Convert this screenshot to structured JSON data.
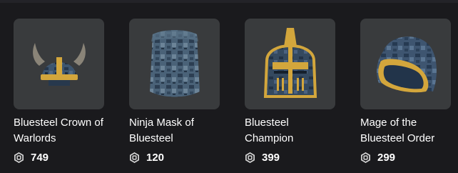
{
  "items": [
    {
      "name": "Bluesteel Crown of Warlords",
      "price": "749",
      "icon": "viking-helmet-image"
    },
    {
      "name": "Ninja Mask of Bluesteel",
      "price": "120",
      "icon": "ninja-mask-image"
    },
    {
      "name": "Bluesteel Champion",
      "price": "399",
      "icon": "knight-helmet-image"
    },
    {
      "name": "Mage of the Bluesteel Order",
      "price": "299",
      "icon": "mage-hood-image"
    }
  ],
  "currency_icon": "robux-icon",
  "colors": {
    "background": "#1a1a1d",
    "card": "#393b3d",
    "steel": "#2f4460",
    "gold": "#d3a63c",
    "text": "#ffffff"
  }
}
